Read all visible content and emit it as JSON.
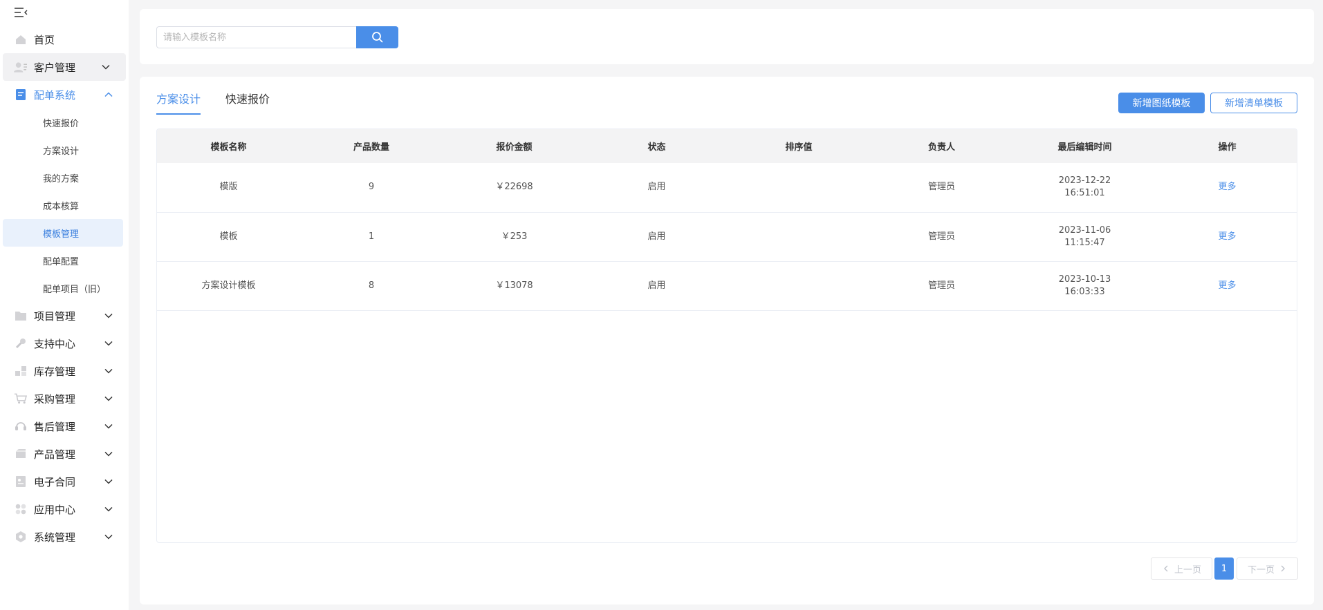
{
  "sidebar": {
    "items": [
      {
        "label": "首页",
        "icon": "home-icon"
      },
      {
        "label": "客户管理",
        "icon": "customer-icon"
      },
      {
        "label": "配单系统",
        "icon": "order-system-icon"
      },
      {
        "label": "项目管理",
        "icon": "folder-icon"
      },
      {
        "label": "支持中心",
        "icon": "wrench-icon"
      },
      {
        "label": "库存管理",
        "icon": "inventory-icon"
      },
      {
        "label": "采购管理",
        "icon": "cart-icon"
      },
      {
        "label": "售后管理",
        "icon": "headset-icon"
      },
      {
        "label": "产品管理",
        "icon": "box-icon"
      },
      {
        "label": "电子合同",
        "icon": "contract-icon"
      },
      {
        "label": "应用中心",
        "icon": "apps-icon"
      },
      {
        "label": "系统管理",
        "icon": "settings-icon"
      }
    ],
    "sub_items": [
      "快速报价",
      "方案设计",
      "我的方案",
      "成本核算",
      "模板管理",
      "配单配置",
      "配单项目（旧）"
    ],
    "accent_color": "#4a8ee8"
  },
  "search": {
    "placeholder": "请输入模板名称"
  },
  "tabs": [
    "方案设计",
    "快速报价"
  ],
  "actions": {
    "add_drawing_template": "新增图纸模板",
    "add_list_template": "新增清单模板"
  },
  "table": {
    "columns": [
      "模板名称",
      "产品数量",
      "报价金额",
      "状态",
      "排序值",
      "负责人",
      "最后编辑时间",
      "操作"
    ],
    "rows": [
      {
        "name": "模版",
        "count": "9",
        "amount": "￥22698",
        "status": "启用",
        "sort": "",
        "owner": "管理员",
        "date": "2023-12-22",
        "time": "16:51:01",
        "action": "更多"
      },
      {
        "name": "模板",
        "count": "1",
        "amount": "￥253",
        "status": "启用",
        "sort": "",
        "owner": "管理员",
        "date": "2023-11-06",
        "time": "11:15:47",
        "action": "更多"
      },
      {
        "name": "方案设计模板",
        "count": "8",
        "amount": "￥13078",
        "status": "启用",
        "sort": "",
        "owner": "管理员",
        "date": "2023-10-13",
        "time": "16:03:33",
        "action": "更多"
      }
    ]
  },
  "pagination": {
    "prev": "上一页",
    "current": "1",
    "next": "下一页"
  }
}
